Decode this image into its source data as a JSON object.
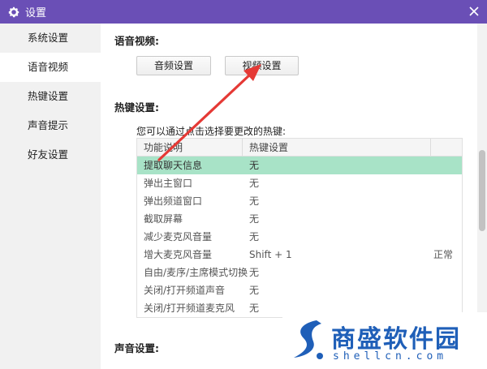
{
  "window": {
    "title": "设置",
    "accent": "#6a4fb6"
  },
  "sidebar": {
    "items": [
      {
        "label": "系统设置"
      },
      {
        "label": "语音视频"
      },
      {
        "label": "热键设置"
      },
      {
        "label": "声音提示"
      },
      {
        "label": "好友设置"
      }
    ],
    "active_index": 1
  },
  "voice_video": {
    "title": "语音视频:",
    "audio_button": "音频设置",
    "video_button": "视频设置"
  },
  "hotkeys": {
    "title": "热键设置:",
    "hint": "您可以通过点击选择要更改的热键:",
    "columns": [
      "功能说明",
      "热键设置",
      ""
    ],
    "rows": [
      {
        "func": "提取聊天信息",
        "key": "无",
        "status": ""
      },
      {
        "func": "弹出主窗口",
        "key": "无",
        "status": ""
      },
      {
        "func": "弹出频道窗口",
        "key": "无",
        "status": ""
      },
      {
        "func": "截取屏幕",
        "key": "无",
        "status": ""
      },
      {
        "func": "减少麦克风音量",
        "key": "无",
        "status": ""
      },
      {
        "func": "增大麦克风音量",
        "key": "Shift + 1",
        "status": "正常"
      },
      {
        "func": "自由/麦序/主席模式切换",
        "key": "无",
        "status": ""
      },
      {
        "func": "关闭/打开频道声音",
        "key": "无",
        "status": ""
      },
      {
        "func": "关闭/打开频道麦克风",
        "key": "无",
        "status": ""
      }
    ],
    "selected_index": 0,
    "selected_color": "#a8e3c7"
  },
  "sound": {
    "title": "声音设置:"
  },
  "watermark": {
    "brand": "商盛软件园",
    "url": "shellcn.com",
    "color": "#1f5fb8"
  }
}
